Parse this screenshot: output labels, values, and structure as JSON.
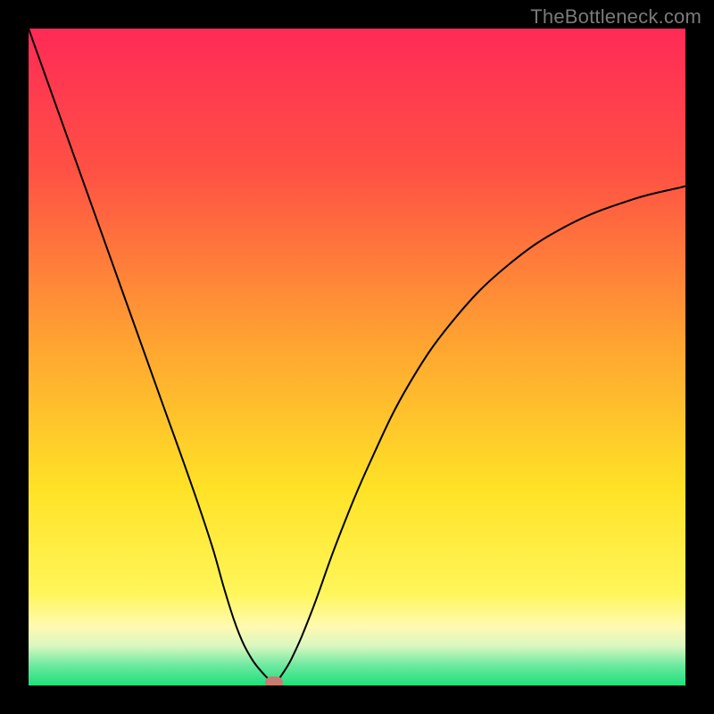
{
  "watermark": "TheBottleneck.com",
  "colors": {
    "frame": "#000000",
    "gradient_stops": [
      {
        "pct": 0,
        "color": "#ff2a57"
      },
      {
        "pct": 22,
        "color": "#ff5244"
      },
      {
        "pct": 48,
        "color": "#ffa431"
      },
      {
        "pct": 70,
        "color": "#ffe226"
      },
      {
        "pct": 86,
        "color": "#fff65a"
      },
      {
        "pct": 91,
        "color": "#fffab0"
      },
      {
        "pct": 94,
        "color": "#d9f7c1"
      },
      {
        "pct": 97,
        "color": "#6be9a0"
      },
      {
        "pct": 100,
        "color": "#1ee079"
      }
    ],
    "curve": "#000000",
    "marker": "#c97b73"
  },
  "chart_data": {
    "type": "line",
    "title": "",
    "xlabel": "",
    "ylabel": "",
    "xlim": [
      0,
      100
    ],
    "ylim": [
      0,
      100
    ],
    "grid": false,
    "legend": false,
    "series": [
      {
        "name": "bottleneck-curve",
        "x": [
          0,
          5,
          10,
          15,
          20,
          25,
          28,
          30,
          32,
          34,
          36,
          37,
          37.5,
          38,
          40,
          43,
          47,
          52,
          58,
          65,
          73,
          82,
          92,
          100
        ],
        "y": [
          100,
          86,
          72,
          58,
          44,
          30,
          21,
          14,
          8,
          4,
          1.5,
          0.6,
          0.2,
          0.8,
          4,
          11,
          22,
          34,
          46,
          56,
          64,
          70,
          74,
          76
        ]
      }
    ],
    "marker": {
      "x": 37.3,
      "y": 0.4
    },
    "notes": "Values are approximate, read visually from the plot. x is horizontal position as percent of inner plot width; y is vertical position as percent of inner plot height from bottom (0 = bottom green, 100 = top red)."
  }
}
